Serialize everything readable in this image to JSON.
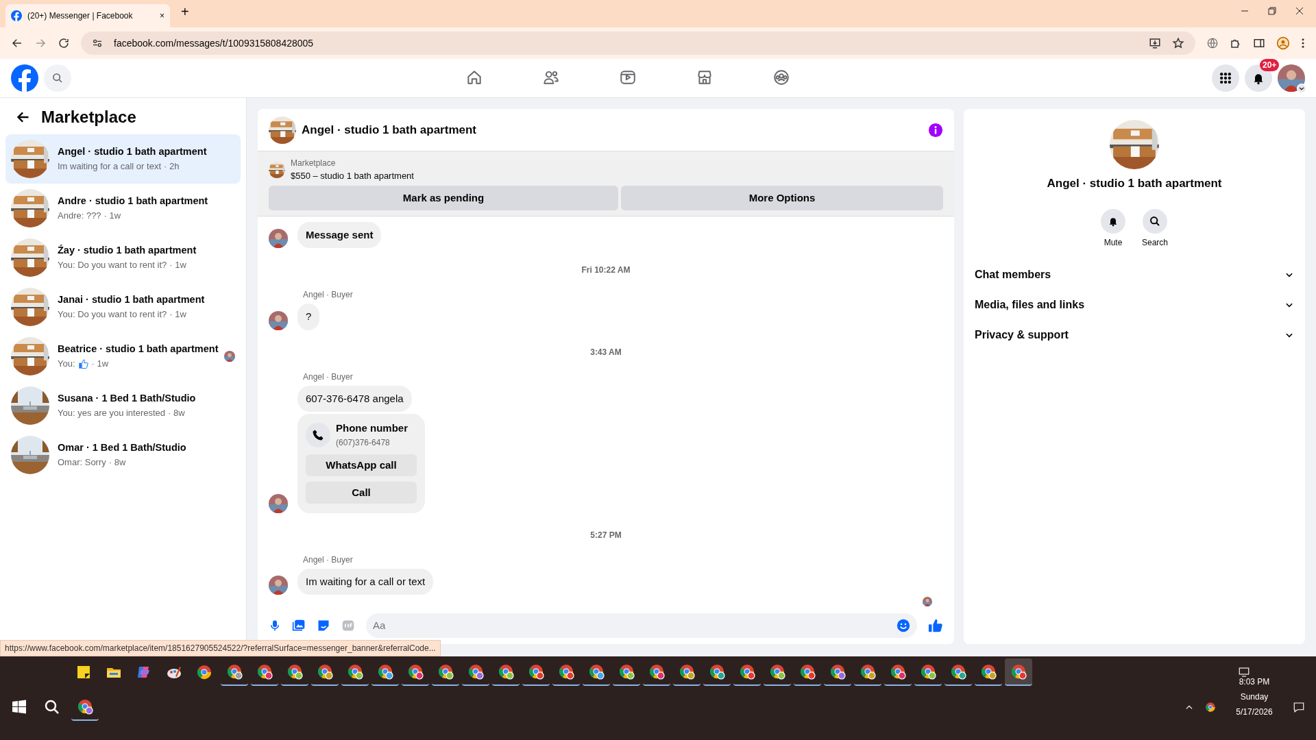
{
  "browser": {
    "tab_title": "(20+) Messenger | Facebook",
    "tab_close": "×",
    "new_tab": "+",
    "url": "facebook.com/messages/t/1009315808428005"
  },
  "header": {
    "nav": [
      {
        "kind": "home",
        "selected": false
      },
      {
        "kind": "friends",
        "selected": false
      },
      {
        "kind": "video",
        "selected": false
      },
      {
        "kind": "marketplace",
        "selected": false
      },
      {
        "kind": "groups",
        "selected": false
      }
    ],
    "notifications_badge": "20+"
  },
  "sidebar": {
    "title": "Marketplace",
    "conversations": [
      {
        "name": "Angel · studio 1 bath apartment",
        "preview": "Im waiting for a call or text",
        "time": "· 2h",
        "selected": true
      },
      {
        "name": "Andre · studio 1 bath apartment",
        "preview": "Andre: ???",
        "time": "· 1w",
        "selected": false
      },
      {
        "name": "Źay · studio 1 bath apartment",
        "preview": "You: Do you want to rent it?",
        "time": "· 1w",
        "selected": false
      },
      {
        "name": "Janai · studio 1 bath apartment",
        "preview": "You: Do you want to rent it?",
        "time": "· 1w",
        "selected": false
      },
      {
        "name": "Beatrice · studio 1 bath apartment",
        "preview": "You:",
        "like": true,
        "time": "· 1w",
        "seen": true,
        "selected": false
      },
      {
        "name": "Susana · 1 Bed 1 Bath/Studio",
        "preview": "You: yes are you interested",
        "time": "· 8w",
        "selected": false
      },
      {
        "name": "Omar · 1 Bed 1 Bath/Studio",
        "preview": "Omar: Sorry",
        "time": "· 8w",
        "selected": false
      }
    ]
  },
  "chat": {
    "title": "Angel · studio 1 bath apartment",
    "banner": {
      "label": "Marketplace",
      "listing": "$550 – studio 1 bath apartment",
      "buttons": [
        "Mark as pending",
        "More Options"
      ]
    },
    "messages": [
      {
        "kind": "bubble",
        "text": "Message sent",
        "avatar": true
      },
      {
        "kind": "time",
        "text": "Fri 10:22 AM"
      },
      {
        "kind": "bubble",
        "sender": "Angel · Buyer",
        "text": "?",
        "avatar": true
      },
      {
        "kind": "time",
        "text": "3:43 AM"
      },
      {
        "kind": "bubble",
        "sender": "Angel · Buyer",
        "text": "607-376-6478 angela",
        "avatar": false
      },
      {
        "kind": "contact",
        "title": "Phone number",
        "detail": "(607)376-6478",
        "buttons": [
          "WhatsApp call",
          "Call"
        ],
        "avatar": true
      },
      {
        "kind": "time",
        "text": "5:27 PM"
      },
      {
        "kind": "bubble",
        "sender": "Angel · Buyer",
        "text": "Im waiting for a call or text",
        "avatar": true
      }
    ],
    "seen": true,
    "composer": {
      "placeholder": "Aa"
    }
  },
  "details": {
    "title": "Angel · studio 1 bath apartment",
    "actions": [
      {
        "kind": "mute",
        "label": "Mute"
      },
      {
        "kind": "search",
        "label": "Search"
      }
    ],
    "sections": [
      {
        "label": "Chat members",
        "expanded": false
      },
      {
        "label": "Media, files and links",
        "expanded": false
      },
      {
        "label": "Privacy & support",
        "expanded": false
      }
    ]
  },
  "status_url": "https://www.facebook.com/marketplace/item/1851627905524522/?referralSurface=messenger_banner&referralCode...",
  "taskbar": {
    "pinned": [
      {
        "kind": "sticky-notes",
        "running": false,
        "selected": false
      },
      {
        "kind": "explorer",
        "running": false,
        "selected": false
      },
      {
        "kind": "copilot",
        "running": false,
        "selected": false
      },
      {
        "kind": "paint",
        "running": false,
        "selected": false
      },
      {
        "kind": "chrome",
        "running": false,
        "selected": false
      },
      {
        "kind": "chrome-profile",
        "running": true,
        "selected": false,
        "color": "#9e9e9e"
      },
      {
        "kind": "chrome-profile",
        "running": true,
        "selected": false,
        "color": "#e0306a"
      },
      {
        "kind": "chrome-profile",
        "running": true,
        "selected": false,
        "color": "#8bc34a"
      },
      {
        "kind": "chrome-profile",
        "running": true,
        "selected": false,
        "color": "#c9a227"
      },
      {
        "kind": "chrome-profile",
        "running": true,
        "selected": false,
        "color": "#8bc34a"
      },
      {
        "kind": "chrome-profile",
        "running": true,
        "selected": false,
        "color": "#42a5f5"
      },
      {
        "kind": "chrome-profile",
        "running": true,
        "selected": false,
        "color": "#e0306a"
      },
      {
        "kind": "chrome-profile",
        "running": true,
        "selected": false,
        "color": "#8bc34a"
      },
      {
        "kind": "chrome-profile",
        "running": true,
        "selected": false,
        "color": "#9c6ade"
      },
      {
        "kind": "chrome-profile",
        "running": true,
        "selected": false,
        "color": "#8bc34a"
      },
      {
        "kind": "chrome-profile",
        "running": true,
        "selected": false,
        "color": "#e53935"
      },
      {
        "kind": "chrome-profile",
        "running": true,
        "selected": false,
        "color": "#e53935"
      },
      {
        "kind": "chrome-profile",
        "running": true,
        "selected": false,
        "color": "#42a5f5"
      },
      {
        "kind": "chrome-profile",
        "running": true,
        "selected": false,
        "color": "#8bc34a"
      },
      {
        "kind": "chrome-profile",
        "running": true,
        "selected": false,
        "color": "#e0306a"
      },
      {
        "kind": "chrome-profile",
        "running": true,
        "selected": false,
        "color": "#c9a227"
      },
      {
        "kind": "chrome-profile",
        "running": true,
        "selected": false,
        "color": "#26a69a"
      },
      {
        "kind": "chrome-profile",
        "running": true,
        "selected": false,
        "color": "#e53935"
      },
      {
        "kind": "chrome-profile",
        "running": true,
        "selected": false,
        "color": "#8bc34a"
      },
      {
        "kind": "chrome-profile",
        "running": true,
        "selected": false,
        "color": "#e53935"
      },
      {
        "kind": "chrome-profile",
        "running": true,
        "selected": false,
        "color": "#9c6ade"
      },
      {
        "kind": "chrome-profile",
        "running": true,
        "selected": false,
        "color": "#c9a227"
      },
      {
        "kind": "chrome-profile",
        "running": true,
        "selected": false,
        "color": "#e0306a"
      },
      {
        "kind": "chrome-profile",
        "running": true,
        "selected": false,
        "color": "#8bc34a"
      },
      {
        "kind": "chrome-profile",
        "running": true,
        "selected": false,
        "color": "#26a69a"
      },
      {
        "kind": "chrome-profile",
        "running": true,
        "selected": false,
        "color": "#c9a227"
      },
      {
        "kind": "chrome-profile",
        "running": true,
        "selected": true,
        "color": "#e53935"
      }
    ],
    "lower": [
      {
        "kind": "start",
        "running": false,
        "selected": false
      },
      {
        "kind": "search",
        "running": false,
        "selected": false
      },
      {
        "kind": "chrome-profile",
        "running": true,
        "selected": false,
        "color": "#9c6ade"
      }
    ],
    "clock": {
      "time": "8:03 PM",
      "day": "Sunday",
      "date": "5/17/2026"
    }
  }
}
